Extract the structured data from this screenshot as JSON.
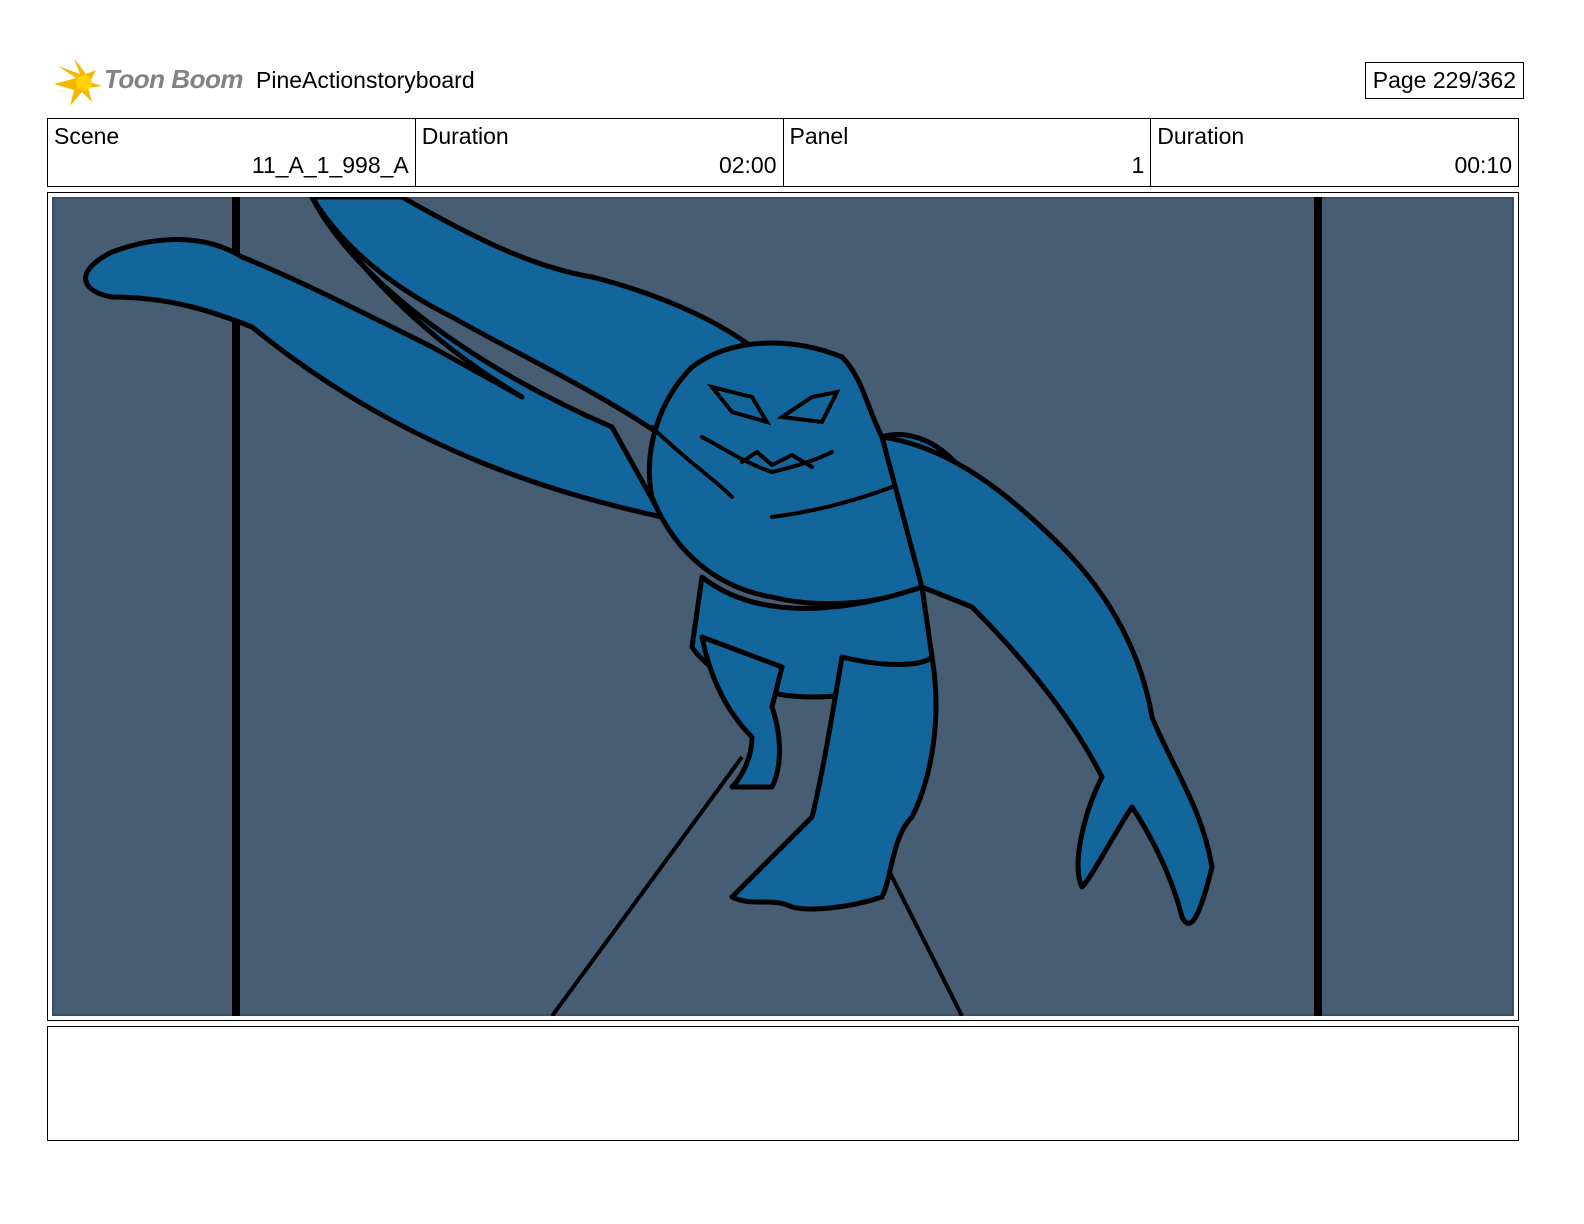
{
  "header": {
    "logo_text": "Toon Boom",
    "project_title": "PineActionstoryboard",
    "page_label": "Page 229/362"
  },
  "info": {
    "scene_label": "Scene",
    "scene_value": "11_A_1_998_A",
    "scene_duration_label": "Duration",
    "scene_duration_value": "02:00",
    "panel_label": "Panel",
    "panel_value": "1",
    "panel_duration_label": "Duration",
    "panel_duration_value": "00:10"
  },
  "panel": {
    "background_color": "#465d73",
    "figure_color": "#13669c",
    "line_color": "#000000"
  },
  "notes": {
    "text": ""
  }
}
